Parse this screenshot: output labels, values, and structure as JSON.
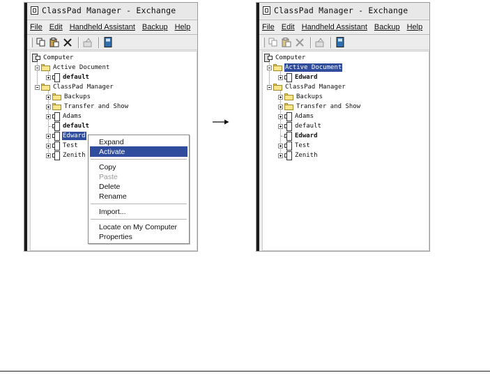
{
  "left_window": {
    "title": "ClassPad Manager - Exchange",
    "menu": [
      "File",
      "Edit",
      "Handheld Assistant",
      "Backup",
      "Help"
    ],
    "toolbar": [
      "copy-icon",
      "paste-icon",
      "delete-icon",
      "tool-icon",
      "calculator-icon"
    ],
    "tree": {
      "computer": "Computer",
      "active_document": "Active Document",
      "active_default": "default",
      "classpad_manager": "ClassPad Manager",
      "backups": "Backups",
      "transfer_and_show": "Transfer and Show",
      "adams": "Adams",
      "default": "default",
      "edward": "Edward",
      "test": "Test",
      "zenith": "Zenith"
    },
    "context_menu": {
      "expand": "Expand",
      "activate": "Activate",
      "copy": "Copy",
      "paste": "Paste",
      "delete": "Delete",
      "rename": "Rename",
      "import": "Import...",
      "locate": "Locate on My Computer",
      "properties": "Properties"
    }
  },
  "right_window": {
    "title": "ClassPad Manager - Exchange",
    "menu": [
      "File",
      "Edit",
      "Handheld Assistant",
      "Backup",
      "Help"
    ],
    "toolbar": [
      "copy-icon",
      "paste-icon",
      "delete-icon",
      "tool-icon",
      "calculator-icon"
    ],
    "tree": {
      "computer": "Computer",
      "active_document": "Active Document",
      "active_edward": "Edward",
      "classpad_manager": "ClassPad Manager",
      "backups": "Backups",
      "transfer_and_show": "Transfer and Show",
      "adams": "Adams",
      "default": "default",
      "edward": "Edward",
      "test": "Test",
      "zenith": "Zenith"
    }
  },
  "colors": {
    "selection": "#2f4d9c",
    "folder": "#f8e58c"
  }
}
